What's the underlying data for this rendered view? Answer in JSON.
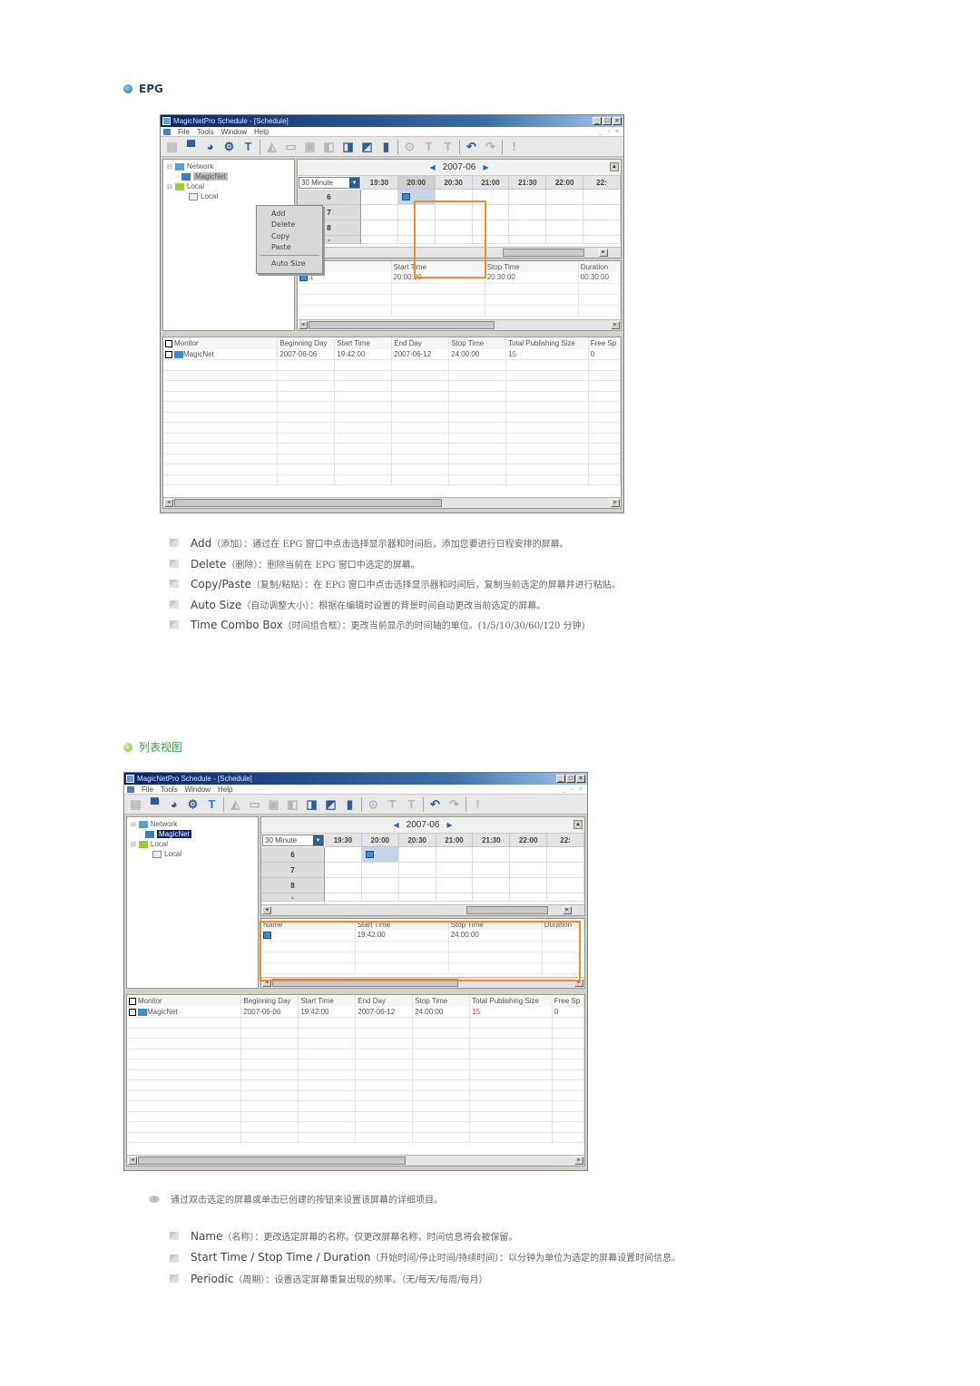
{
  "section1": {
    "title": "EPG",
    "icon": "blue-dot-bullet"
  },
  "section2": {
    "title": "列表视图",
    "icon": "green-dot-bullet"
  },
  "window": {
    "title": "MagicNetPro Schedule - [Schedule]",
    "title_buttons": [
      "_",
      "□",
      "×"
    ],
    "menu": [
      "File",
      "Tools",
      "Window",
      "Help"
    ],
    "mdi_buttons": "_ ▫ ×",
    "toolbar_icons": [
      {
        "name": "printer-icon",
        "glyph": "▤",
        "style": "gray"
      },
      {
        "name": "monitor-icon",
        "glyph": "▀",
        "style": "blue"
      },
      {
        "name": "clock-icon",
        "glyph": "◕",
        "style": "blue"
      },
      {
        "name": "monitor-settings-icon",
        "glyph": "⚙",
        "style": "blue"
      },
      {
        "name": "text-icon",
        "glyph": "T",
        "style": "teal"
      },
      {
        "name": "open-icon",
        "glyph": "◭",
        "style": "gray"
      },
      {
        "name": "save-icon",
        "glyph": "▭",
        "style": "gray"
      },
      {
        "name": "image-icon",
        "glyph": "▣",
        "style": "gray"
      },
      {
        "name": "add-screen-icon",
        "glyph": "◧",
        "style": "gray"
      },
      {
        "name": "copy-screen-icon",
        "glyph": "◨",
        "style": "blue"
      },
      {
        "name": "network-icon",
        "glyph": "◩",
        "style": "blue"
      },
      {
        "name": "delete-icon",
        "glyph": "▮",
        "style": "blue"
      },
      {
        "name": "refresh-icon",
        "glyph": "⊙",
        "style": "gray"
      },
      {
        "name": "text-align-icon",
        "glyph": "T",
        "style": "gray"
      },
      {
        "name": "text-format-icon",
        "glyph": "T",
        "style": "gray"
      },
      {
        "name": "undo-icon",
        "glyph": "↶",
        "style": "blue"
      },
      {
        "name": "redo-icon",
        "glyph": "↷",
        "style": "gray"
      },
      {
        "name": "info-icon",
        "glyph": "!",
        "style": "gray"
      }
    ],
    "tree": [
      {
        "label": "Network",
        "level": 0
      },
      {
        "label": "MagicNet",
        "level": 1
      },
      {
        "label": "Local",
        "level": 0
      },
      {
        "label": "Local",
        "level": 1
      }
    ],
    "epg": {
      "month": "2007-06",
      "time_unit": "30 Minute",
      "time_columns": [
        "19:30",
        "20:00",
        "20:30",
        "21:00",
        "21:30",
        "22:00",
        "22:"
      ],
      "rows": [
        "6",
        "7",
        "8",
        "-"
      ]
    },
    "schedule_columns": [
      "Name",
      "Start Time",
      "Stop Time",
      "Duration"
    ],
    "monitor_columns": [
      "Monitor",
      "Beginning Day",
      "Start Time",
      "End Day",
      "Stop Time",
      "Total Publishing Size",
      "Free Sp"
    ],
    "monitor_row": {
      "monitor": "MagicNet",
      "beginning_day": "2007-06-06",
      "start_time": "19:42:00",
      "end_day": "2007-06-12",
      "stop_time": "24:00:00",
      "total_publishing_size": "15",
      "free_space": "0"
    }
  },
  "window1": {
    "schedule_row": {
      "name": "1",
      "start_time": "20:00:00",
      "stop_time": "20:30:00",
      "duration": "00:30:00"
    },
    "context_menu": [
      "Add",
      "Delete",
      "Copy",
      "Paste",
      "Auto Size"
    ]
  },
  "window2": {
    "schedule_row": {
      "name": "",
      "start_time": "19:42:00",
      "stop_time": "24:00:00",
      "duration": ""
    }
  },
  "epg_bullets": [
    {
      "term": "Add",
      "desc": "（添加）：通过在 EPG 窗口中点击选择显示器和时间后，添加您要进行日程安排的屏幕。"
    },
    {
      "term": "Delete",
      "desc": "（删除）：删除当前在 EPG 窗口中选定的屏幕。"
    },
    {
      "term": "Copy/Paste",
      "desc": "（复制/粘贴）：在 EPG 窗口中点击选择显示器和时间后，复制当前选定的屏幕并进行粘贴。"
    },
    {
      "term": "Auto Size",
      "desc": "（自动调整大小）：根据在编辑时设置的背景时间自动更改当前选定的屏幕。"
    },
    {
      "term": "Time Combo Box",
      "desc": "（时间组合框）：更改当前显示的时间轴的单位。(1/5/10/30/60/120 分钟)"
    }
  ],
  "list_note": "通过双击选定的屏幕或单击已创建的按钮来设置该屏幕的详细项目。",
  "list_bullets": [
    {
      "term": "Name",
      "desc": "（名称）：更改选定屏幕的名称。仅更改屏幕名称，时间信息将会被保留。"
    },
    {
      "term": "Start Time / Stop Time / Duration",
      "desc": "（开始时间/停止时间/持续时间）：以分钟为单位为选定的屏幕设置时间信息。"
    },
    {
      "term": "Periodic",
      "desc": "（周期）：设置选定屏幕重复出现的频率。（无/每天/每周/每月）"
    }
  ]
}
